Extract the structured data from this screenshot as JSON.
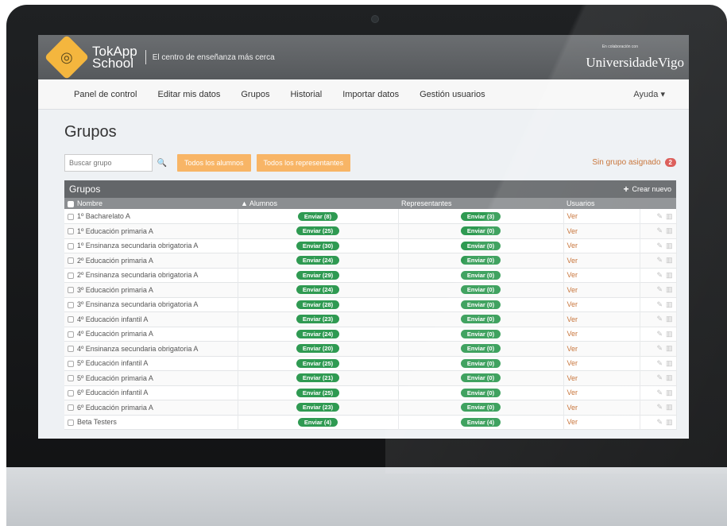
{
  "header": {
    "brand_line1": "TokApp",
    "brand_line2": "School",
    "tagline": "El centro de enseñanza más cerca",
    "collab_label": "En colaboración con",
    "university": "UniversidadeVigo"
  },
  "nav": {
    "items": [
      "Panel de control",
      "Editar mis datos",
      "Grupos",
      "Historial",
      "Importar datos",
      "Gestión usuarios"
    ],
    "help": "Ayuda ▾"
  },
  "page": {
    "title": "Grupos",
    "search_placeholder": "Buscar grupo",
    "btn_all_students": "Todos los alumnos",
    "btn_all_reps": "Todos los representantes",
    "no_group_label": "Sin grupo asignado",
    "no_group_count": "2"
  },
  "panel": {
    "title": "Grupos",
    "create_label": "Crear nuevo",
    "columns": [
      "Nombre",
      "Alumnos",
      "Representantes",
      "Usuarios"
    ],
    "rows": [
      {
        "name": "1º Bacharelato A",
        "alumnos": "Enviar (8)",
        "reps": "Enviar (3)",
        "usuarios": "Ver"
      },
      {
        "name": "1º Educación primaria A",
        "alumnos": "Enviar (25)",
        "reps": "Enviar (0)",
        "usuarios": "Ver"
      },
      {
        "name": "1º Ensinanza secundaria obrigatoria A",
        "alumnos": "Enviar (30)",
        "reps": "Enviar (0)",
        "usuarios": "Ver"
      },
      {
        "name": "2º Educación primaria A",
        "alumnos": "Enviar (24)",
        "reps": "Enviar (0)",
        "usuarios": "Ver"
      },
      {
        "name": "2º Ensinanza secundaria obrigatoria A",
        "alumnos": "Enviar (29)",
        "reps": "Enviar (0)",
        "usuarios": "Ver"
      },
      {
        "name": "3º Educación primaria A",
        "alumnos": "Enviar (24)",
        "reps": "Enviar (0)",
        "usuarios": "Ver"
      },
      {
        "name": "3º Ensinanza secundaria obrigatoria A",
        "alumnos": "Enviar (28)",
        "reps": "Enviar (0)",
        "usuarios": "Ver"
      },
      {
        "name": "4º Educación infantil A",
        "alumnos": "Enviar (23)",
        "reps": "Enviar (0)",
        "usuarios": "Ver"
      },
      {
        "name": "4º Educación primaria A",
        "alumnos": "Enviar (24)",
        "reps": "Enviar (0)",
        "usuarios": "Ver"
      },
      {
        "name": "4º Ensinanza secundaria obrigatoria A",
        "alumnos": "Enviar (20)",
        "reps": "Enviar (0)",
        "usuarios": "Ver"
      },
      {
        "name": "5º Educación infantil A",
        "alumnos": "Enviar (25)",
        "reps": "Enviar (0)",
        "usuarios": "Ver"
      },
      {
        "name": "5º Educación primaria A",
        "alumnos": "Enviar (21)",
        "reps": "Enviar (0)",
        "usuarios": "Ver"
      },
      {
        "name": "6º Educación infantil A",
        "alumnos": "Enviar (25)",
        "reps": "Enviar (0)",
        "usuarios": "Ver"
      },
      {
        "name": "6º Educación primaria A",
        "alumnos": "Enviar (23)",
        "reps": "Enviar (0)",
        "usuarios": "Ver"
      },
      {
        "name": "Beta Testers",
        "alumnos": "Enviar (4)",
        "reps": "Enviar (4)",
        "usuarios": "Ver"
      }
    ]
  },
  "icons": {
    "search": "search-icon",
    "plus": "plus-icon",
    "edit": "edit-icon",
    "delete": "trash-icon",
    "sort": "sort-up-icon"
  },
  "colors": {
    "accent_orange": "#f8b566",
    "send_green": "#2f9a52",
    "badge_red": "#d9534f",
    "link_brown": "#c46a2b"
  }
}
